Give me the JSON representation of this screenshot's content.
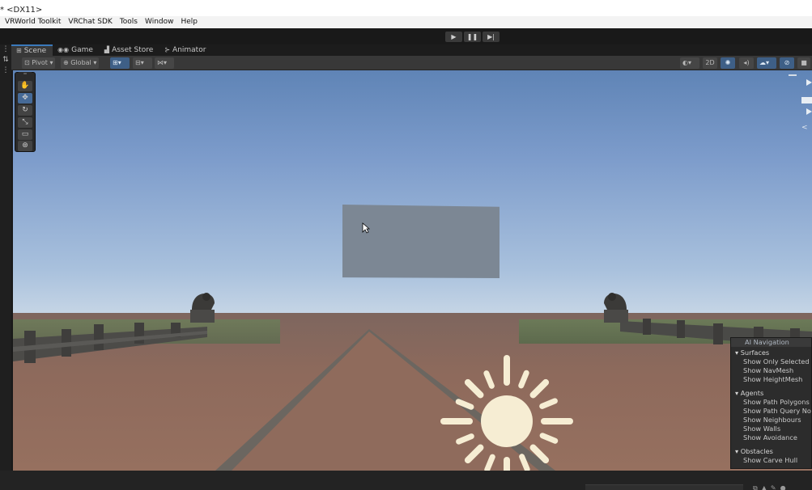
{
  "window": {
    "title": "* <DX11>"
  },
  "menu": [
    "VRWorld Toolkit",
    "VRChat SDK",
    "Tools",
    "Window",
    "Help"
  ],
  "play_controls": {
    "play": "▶",
    "pause": "❚❚",
    "step": "▶|"
  },
  "tabs": [
    {
      "label": "Scene",
      "icon": "grid-icon",
      "glyph": "⊞",
      "active": true
    },
    {
      "label": "Game",
      "icon": "gamepad-icon",
      "glyph": "◉◉",
      "active": false
    },
    {
      "label": "Asset Store",
      "icon": "shopping-bag-icon",
      "glyph": "▟",
      "active": false
    },
    {
      "label": "Animator",
      "icon": "animator-icon",
      "glyph": "⊱",
      "active": false
    }
  ],
  "scene_toolbar": {
    "pivot": "Pivot",
    "global": "Global",
    "two_d": "2D"
  },
  "ai_navigation": {
    "title": "AI Navigation",
    "sections": [
      {
        "label": "Surfaces",
        "items": [
          "Show Only Selected",
          "Show NavMesh",
          "Show HeightMesh"
        ]
      },
      {
        "label": "Agents",
        "items": [
          "Show Path Polygons",
          "Show Path Query Nodes",
          "Show Neighbours",
          "Show Walls",
          "Show Avoidance"
        ]
      },
      {
        "label": "Obstacles",
        "items": [
          "Show Carve Hull"
        ]
      }
    ]
  },
  "colors": {
    "accent": "#3a79bb",
    "panel": "#383838",
    "sun": "#f6edd3"
  }
}
